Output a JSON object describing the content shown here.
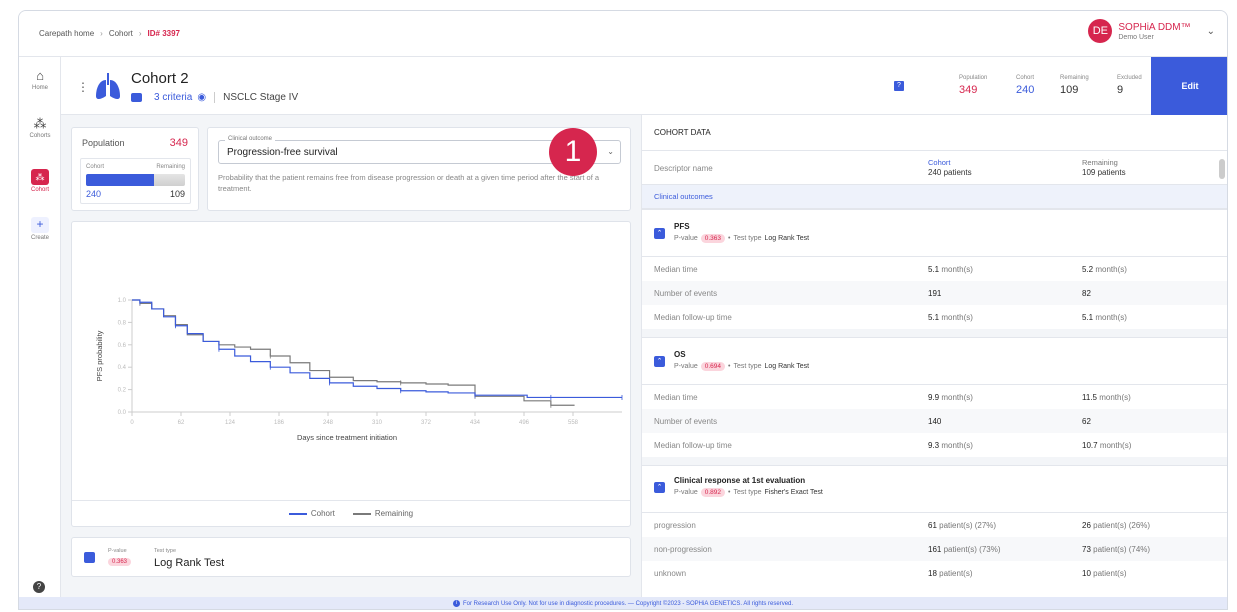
{
  "breadcrumb": [
    "Carepath home",
    "Cohort",
    "ID# 3397"
  ],
  "user": {
    "initials": "DE",
    "name": "SOPHiA DDM™",
    "role": "Demo User"
  },
  "rail": {
    "home": "Home",
    "cohorts": "Cohorts",
    "cohort": "Cohort",
    "create": "Create"
  },
  "cohort": {
    "title": "Cohort 2",
    "criteria": "3 criteria",
    "stage": "NSCLC Stage IV",
    "help": "?"
  },
  "stats": [
    {
      "label": "Population",
      "value": "349",
      "color": "#d6264e"
    },
    {
      "label": "Cohort",
      "value": "240",
      "color": "#3b5bdb"
    },
    {
      "label": "Remaining",
      "value": "109",
      "color": "#333333"
    },
    {
      "label": "Excluded",
      "value": "9",
      "color": "#333333"
    }
  ],
  "edit_label": "Edit",
  "population": {
    "label": "Population",
    "value": "349",
    "cohort_label": "Cohort",
    "remaining_label": "Remaining",
    "cohort": "240",
    "remaining": "109",
    "cohort_fraction": 0.688
  },
  "outcome": {
    "legend": "Clinical outcome",
    "value": "Progression-free survival",
    "description": "Probability that the patient remains free from disease progression or death at a given time period after the start of a treatment."
  },
  "step_badge": "1",
  "chart_data": {
    "type": "line",
    "title": "",
    "xlabel": "Days since treatment initiation",
    "ylabel": "PFS probability",
    "xlim": [
      0,
      620
    ],
    "ylim": [
      0,
      1.0
    ],
    "xticks": [
      "0",
      "62",
      "124",
      "186",
      "248",
      "310",
      "372",
      "434",
      "496",
      "558"
    ],
    "yticks": [
      "0.0",
      "0.2",
      "0.4",
      "0.6",
      "0.8",
      "1.0"
    ],
    "legend_position": "bottom",
    "series": [
      {
        "name": "Cohort",
        "color": "#3b5bdb",
        "x": [
          0,
          10,
          25,
          40,
          55,
          70,
          90,
          110,
          130,
          150,
          175,
          200,
          225,
          250,
          280,
          310,
          340,
          372,
          400,
          434,
          470,
          500,
          530,
          560,
          590,
          620
        ],
        "y": [
          1.0,
          0.98,
          0.92,
          0.85,
          0.77,
          0.7,
          0.63,
          0.56,
          0.5,
          0.45,
          0.4,
          0.35,
          0.3,
          0.26,
          0.23,
          0.21,
          0.19,
          0.18,
          0.17,
          0.15,
          0.15,
          0.13,
          0.13,
          0.13,
          0.13,
          0.13
        ]
      },
      {
        "name": "Remaining",
        "color": "#7a7a7a",
        "x": [
          0,
          10,
          25,
          40,
          55,
          70,
          90,
          110,
          130,
          150,
          175,
          200,
          225,
          250,
          280,
          310,
          340,
          372,
          400,
          434,
          470,
          496,
          530,
          560
        ],
        "y": [
          1.0,
          0.97,
          0.92,
          0.86,
          0.78,
          0.69,
          0.63,
          0.6,
          0.58,
          0.56,
          0.5,
          0.44,
          0.37,
          0.31,
          0.28,
          0.27,
          0.26,
          0.25,
          0.24,
          0.14,
          0.14,
          0.1,
          0.06,
          0.06
        ]
      }
    ]
  },
  "test": {
    "pvalue_label": "P-value",
    "pvalue": "0.363",
    "type_label": "Test type",
    "type": "Log Rank Test"
  },
  "cohort_data": {
    "header": "COHORT DATA",
    "descriptor_label": "Descriptor name",
    "cohort_title": "Cohort",
    "cohort_sub": "240 patients",
    "remaining_title": "Remaining",
    "remaining_sub": "109 patients",
    "section": "Clinical outcomes",
    "p_label": "P-value",
    "test_type_label": "Test type",
    "blocks": [
      {
        "name": "PFS",
        "pvalue": "0.363",
        "test": "Log Rank Test",
        "rows": [
          {
            "label": "Median time",
            "cohort": "5.1",
            "cohort_unit": "month(s)",
            "remaining": "5.2",
            "remaining_unit": "month(s)"
          },
          {
            "label": "Number of events",
            "cohort": "191",
            "cohort_unit": "",
            "remaining": "82",
            "remaining_unit": ""
          },
          {
            "label": "Median follow-up time",
            "cohort": "5.1",
            "cohort_unit": "month(s)",
            "remaining": "5.1",
            "remaining_unit": "month(s)"
          }
        ]
      },
      {
        "name": "OS",
        "pvalue": "0.694",
        "test": "Log Rank Test",
        "rows": [
          {
            "label": "Median time",
            "cohort": "9.9",
            "cohort_unit": "month(s)",
            "remaining": "11.5",
            "remaining_unit": "month(s)"
          },
          {
            "label": "Number of events",
            "cohort": "140",
            "cohort_unit": "",
            "remaining": "62",
            "remaining_unit": ""
          },
          {
            "label": "Median follow-up time",
            "cohort": "9.3",
            "cohort_unit": "month(s)",
            "remaining": "10.7",
            "remaining_unit": "month(s)"
          }
        ]
      },
      {
        "name": "Clinical response at 1st evaluation",
        "pvalue": "0.892",
        "test": "Fisher's Exact Test",
        "rows": [
          {
            "label": "progression",
            "cohort": "61",
            "cohort_unit": "patient(s) (27%)",
            "remaining": "26",
            "remaining_unit": "patient(s) (26%)"
          },
          {
            "label": "non-progression",
            "cohort": "161",
            "cohort_unit": "patient(s) (73%)",
            "remaining": "73",
            "remaining_unit": "patient(s) (74%)"
          },
          {
            "label": "unknown",
            "cohort": "18",
            "cohort_unit": "patient(s)",
            "remaining": "10",
            "remaining_unit": "patient(s)"
          }
        ]
      }
    ]
  },
  "footer": "For Research Use Only. Not for use in diagnostic procedures. — Copyright ©2023 - SOPHiA GENETICS. All rights reserved."
}
